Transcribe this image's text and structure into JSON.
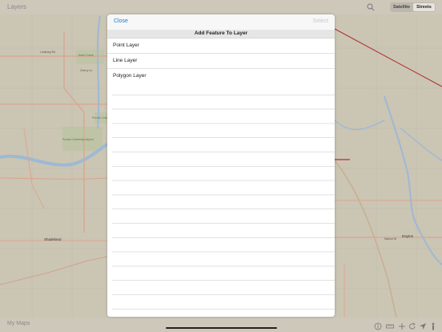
{
  "header": {
    "title": "Layers",
    "segments": [
      "Satellite",
      "Streets"
    ],
    "selected_segment": "Streets"
  },
  "modal": {
    "close_label": "Close",
    "select_label": "Select",
    "section_title": "Add Feature To Layer",
    "items": [
      {
        "label": "Point Layer"
      },
      {
        "label": "Line Layer"
      },
      {
        "label": "Polygon Layer"
      }
    ]
  },
  "footer": {
    "my_maps_label": "My Maps"
  },
  "map_labels": {
    "lindborg": "Lindborg Rd",
    "sand_creek": "Sand Creek",
    "cherry_ln": "Cherry Ln",
    "airport": "Purdue University Airport",
    "purdue": "Purdue University",
    "shadeland": "Shadeland",
    "dayton": "Dayton",
    "walnut": "Walnut St"
  },
  "colors": {
    "accent": "#1e78d4",
    "map_bg": "#cbc5b4",
    "red_line": "#b03030"
  }
}
